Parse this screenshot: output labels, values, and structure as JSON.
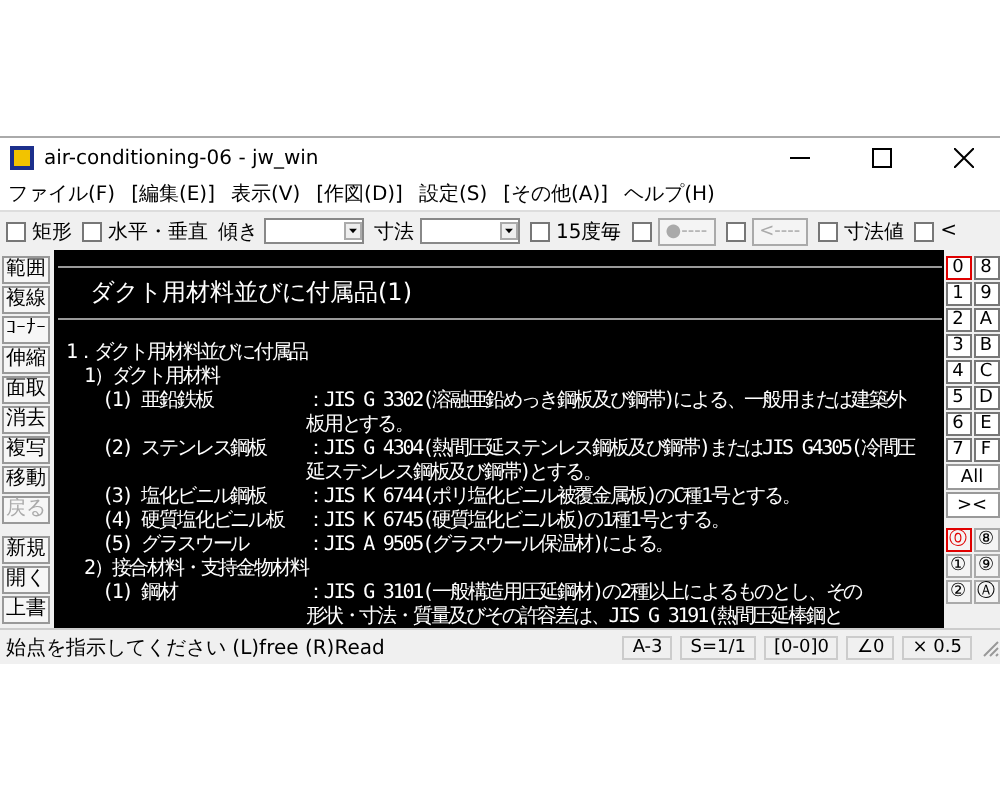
{
  "window": {
    "title": "air-conditioning-06 - jw_win"
  },
  "menu": [
    "ファイル(F)",
    "[編集(E)]",
    "表示(V)",
    "[作図(D)]",
    "設定(S)",
    "[その他(A)]",
    "ヘルプ(H)"
  ],
  "toolbar": [
    {
      "kind": "checkbox",
      "label": "矩形",
      "checked": false
    },
    {
      "kind": "checkbox",
      "label": "水平・垂直",
      "checked": false
    },
    {
      "kind": "combo",
      "label": "傾き"
    },
    {
      "kind": "combo",
      "label": "寸法"
    },
    {
      "kind": "checkbox",
      "label": "15度毎",
      "checked": false
    },
    {
      "kind": "checkbutton",
      "checked": false,
      "button": "●----",
      "disabled": true
    },
    {
      "kind": "checkbutton",
      "checked": false,
      "button": "<----",
      "disabled": true
    },
    {
      "kind": "checkbox",
      "label": "寸法値",
      "checked": false
    },
    {
      "kind": "checkbox",
      "label": "<",
      "checked": false
    }
  ],
  "tool_groups": [
    {
      "items": [
        {
          "label": "範囲",
          "disabled": false
        },
        {
          "label": "複線",
          "disabled": false
        },
        {
          "label": "ｺｰﾅｰ",
          "disabled": false
        },
        {
          "label": "伸縮",
          "disabled": false
        },
        {
          "label": "面取",
          "disabled": false
        },
        {
          "label": "消去",
          "disabled": false
        },
        {
          "label": "複写",
          "disabled": false
        },
        {
          "label": "移動",
          "disabled": false
        },
        {
          "label": "戻る",
          "disabled": true
        }
      ]
    },
    {
      "items": [
        {
          "label": "新規",
          "disabled": false
        },
        {
          "label": "開く",
          "disabled": false
        },
        {
          "label": "上書",
          "disabled": false
        }
      ]
    }
  ],
  "canvas": {
    "heading": "ダクト用材料並びに付属品(1)",
    "items": [
      {
        "label": "1．ダクト用材料並びに付属品",
        "children": [
          {
            "label": "1）ダクト用材料",
            "children": [
              {
                "label": "(1) 亜鉛鉄板",
                "spec": [
                  "：JIS G 3302(溶融亜鉛めっき鋼板及び鋼帯)による、一般用または建築外",
                  "板用とする。"
                ]
              },
              {
                "label": "(2) ステンレス鋼板",
                "spec": [
                  "：JIS G 4304(熱間圧延ステンレス鋼板及び鋼帯)またはJIS G4305(冷間圧",
                  "延ステンレス鋼板及び鋼帯)とする。"
                ]
              },
              {
                "label": "(3) 塩化ビニル鋼板",
                "spec": [
                  "：JIS K 6744(ポリ塩化ビニル被覆金属板)のC種1号とする。"
                ]
              },
              {
                "label": "(4) 硬質塩化ビニル板",
                "spec": [
                  "：JIS K 6745(硬質塩化ビニル板)の1種1号とする。"
                ]
              },
              {
                "label": "(5) グラスウール",
                "spec": [
                  "：JIS A 9505(グラスウール保温材)による。"
                ]
              }
            ]
          },
          {
            "label": "2）接合材料・支持金物材料",
            "children": [
              {
                "label": "(1) 鋼材",
                "spec": [
                  "：JIS G 3101(一般構造用圧延鋼材)の2種以上によるものとし、その",
                  "形状・寸法・質量及びその許容差は、JIS G 3191(熱間圧延棒鋼と"
                ]
              }
            ]
          }
        ]
      }
    ]
  },
  "layer_groups": [
    {
      "label": "0",
      "selected": true
    },
    {
      "label": "8",
      "selected": false
    },
    {
      "label": "1",
      "selected": false
    },
    {
      "label": "9",
      "selected": false
    },
    {
      "label": "2",
      "selected": false
    },
    {
      "label": "A",
      "selected": false
    },
    {
      "label": "3",
      "selected": false
    },
    {
      "label": "B",
      "selected": false
    },
    {
      "label": "4",
      "selected": false
    },
    {
      "label": "C",
      "selected": false
    },
    {
      "label": "5",
      "selected": false
    },
    {
      "label": "D",
      "selected": false
    },
    {
      "label": "6",
      "selected": false
    },
    {
      "label": "E",
      "selected": false
    },
    {
      "label": "7",
      "selected": false
    },
    {
      "label": "F",
      "selected": false
    }
  ],
  "layer_buttons": [
    "All",
    "><"
  ],
  "layers": [
    {
      "label": "⓪",
      "selected": true
    },
    {
      "label": "⑧",
      "selected": false
    },
    {
      "label": "①",
      "selected": false
    },
    {
      "label": "⑨",
      "selected": false
    },
    {
      "label": "②",
      "selected": false
    },
    {
      "label": "Ⓐ",
      "selected": false
    }
  ],
  "status_bar": {
    "message": "始点を指示してください (L)free (R)Read",
    "fields": [
      "A-3",
      "S=1/1",
      "[0-0]0",
      "∠0",
      "× 0.5"
    ]
  }
}
